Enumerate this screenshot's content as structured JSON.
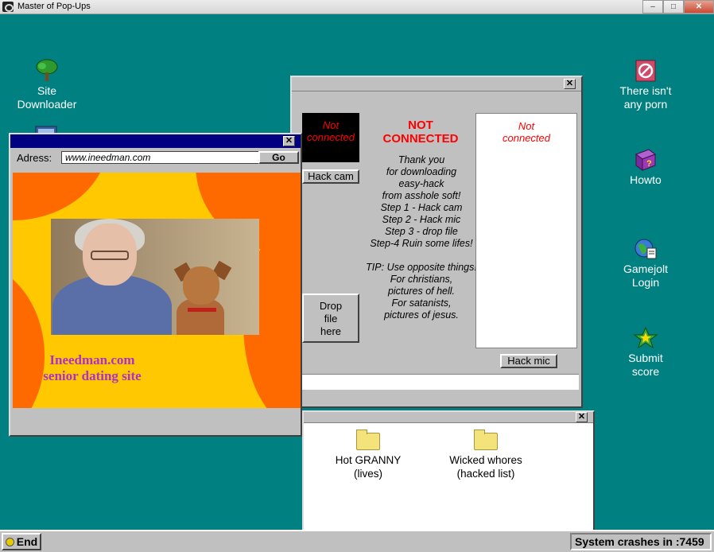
{
  "host_window": {
    "title": "Master of Pop-Ups",
    "minimize": "–",
    "maximize": "□",
    "close": "✕"
  },
  "desktop_icons": [
    {
      "label_line1": "Site",
      "label_line2": "Downloader",
      "icon": "tree-icon"
    },
    {
      "label_line1": "There isn't",
      "label_line2": "any porn",
      "icon": "no-sign-icon"
    },
    {
      "label_line1": "Howto",
      "label_line2": "",
      "icon": "help-book-icon"
    },
    {
      "label_line1": "Gamejolt",
      "label_line2": "Login",
      "icon": "globe-icon"
    },
    {
      "label_line1": "Submit",
      "label_line2": "score",
      "icon": "star-icon"
    }
  ],
  "browser": {
    "address_label": "Adress:",
    "address_value": "www.ineedman.com",
    "go_label": "Go",
    "close_label": "✕",
    "ad_line1": "Ineedman.com",
    "ad_line2": "senior dating site"
  },
  "hack_tool": {
    "close_label": "✕",
    "cam_status": [
      "Not",
      "connected"
    ],
    "hack_cam_label": "Hack cam",
    "status_line1": "NOT",
    "status_line2": "CONNECTED",
    "instructions": [
      "Thank you",
      "for downloading",
      "easy-hack",
      "from asshole soft!",
      "Step 1 - Hack cam",
      "Step 2 - Hack mic",
      "Step 3 - drop file",
      "Step-4 Ruin some lifes!",
      "",
      "TIP: Use opposite things!",
      "For christians,",
      "pictures of hell.",
      "For satanists,",
      "pictures of jesus."
    ],
    "drop_zone": [
      "Drop",
      "file",
      "here"
    ],
    "mic_status": [
      "Not",
      "connected"
    ],
    "hack_mic_label": "Hack mic"
  },
  "folder_window": {
    "close_label": "✕",
    "folders": [
      {
        "line1": "Hot GRANNY",
        "line2": "(lives)"
      },
      {
        "line1": "Wicked whores",
        "line2": "(hacked list)"
      }
    ]
  },
  "taskbar": {
    "end_label": "End",
    "crash_text": "System crashes in :7459"
  },
  "colors": {
    "desktop": "#008080",
    "window_face": "#c0c0c0",
    "title_active": "#000080",
    "status_red": "#ff0000",
    "ad_yellow": "#ffc800",
    "ad_orange": "#ff6a00",
    "ad_text": "#b030c8"
  }
}
